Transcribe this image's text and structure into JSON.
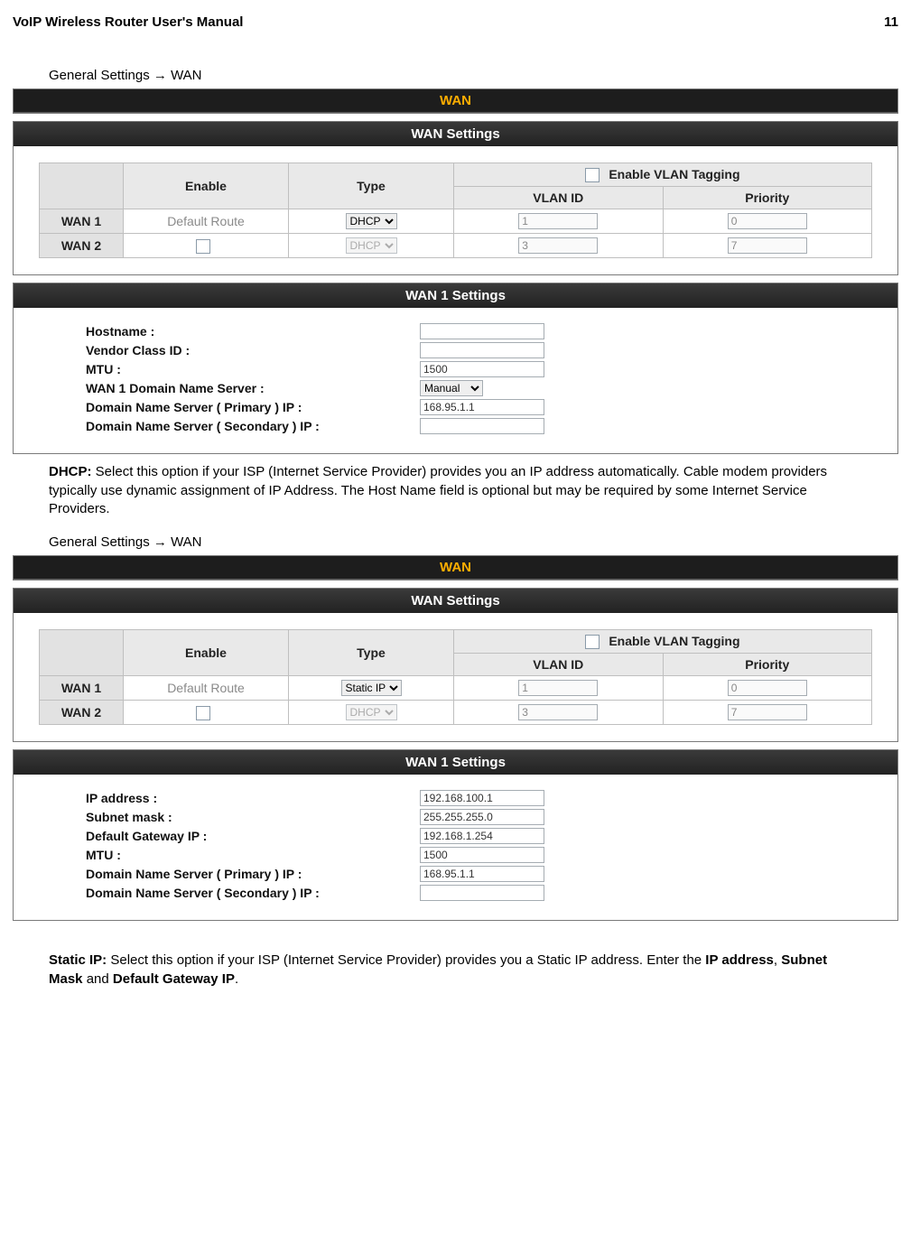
{
  "header": {
    "title": "VoIP Wireless Router User's Manual",
    "page_num": "11"
  },
  "breadcrumb": "General Settings → WAN",
  "panel_labels": {
    "wan": "WAN",
    "wan_settings": "WAN Settings",
    "wan1_settings": "WAN 1 Settings"
  },
  "wan_table_headers": {
    "blank": "",
    "enable": "Enable",
    "type": "Type",
    "enable_vlan": "Enable VLAN Tagging",
    "vlan_id": "VLAN ID",
    "priority": "Priority"
  },
  "block1": {
    "rows": [
      {
        "name": "WAN 1",
        "enable_text": "Default Route",
        "is_default": true,
        "type": "DHCP",
        "type_disabled": false,
        "vlan": "1",
        "prio": "0"
      },
      {
        "name": "WAN 2",
        "enable_text": "",
        "is_default": false,
        "type": "DHCP",
        "type_disabled": true,
        "vlan": "3",
        "prio": "7"
      }
    ],
    "wan1": {
      "hostname": {
        "label": "Hostname  :",
        "value": ""
      },
      "vendor": {
        "label": "Vendor Class ID :",
        "value": ""
      },
      "mtu": {
        "label": "MTU :",
        "value": "1500"
      },
      "dns_mode": {
        "label": "WAN 1 Domain Name Server :",
        "value": "Manual"
      },
      "dns1": {
        "label": "Domain Name Server ( Primary ) IP :",
        "value": "168.95.1.1"
      },
      "dns2": {
        "label": "Domain Name Server ( Secondary ) IP :",
        "value": ""
      }
    },
    "desc": {
      "lead": "DHCP:",
      "rest": " Select this option if your ISP (Internet Service Provider) provides you an IP address automatically. Cable modem providers typically use dynamic assignment of IP Address. The Host Name field is optional but may be required by some Internet Service Providers."
    }
  },
  "block2": {
    "rows": [
      {
        "name": "WAN 1",
        "enable_text": "Default Route",
        "is_default": true,
        "type": "Static IP",
        "type_disabled": false,
        "vlan": "1",
        "prio": "0"
      },
      {
        "name": "WAN 2",
        "enable_text": "",
        "is_default": false,
        "type": "DHCP",
        "type_disabled": true,
        "vlan": "3",
        "prio": "7"
      }
    ],
    "wan1": {
      "ip": {
        "label": "IP address :",
        "value": "192.168.100.1"
      },
      "mask": {
        "label": "Subnet mask :",
        "value": "255.255.255.0"
      },
      "gw": {
        "label": "Default Gateway IP :",
        "value": "192.168.1.254"
      },
      "mtu": {
        "label": "MTU :",
        "value": "1500"
      },
      "dns1": {
        "label": "Domain Name Server ( Primary ) IP :",
        "value": "168.95.1.1"
      },
      "dns2": {
        "label": "Domain Name Server ( Secondary ) IP :",
        "value": ""
      }
    },
    "desc": {
      "lead": "Static IP:",
      "mid": " Select this option if your ISP (Internet Service Provider) provides you a Static IP address. Enter the ",
      "b1": "IP address",
      "c1": ", ",
      "b2": "Subnet Mask",
      "c2": " and ",
      "b3": "Default Gateway IP",
      "end": "."
    }
  }
}
